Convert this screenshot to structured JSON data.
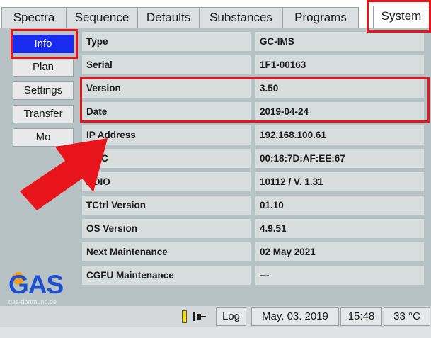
{
  "tabs": [
    {
      "label": "Spectra"
    },
    {
      "label": "Sequence"
    },
    {
      "label": "Defaults"
    },
    {
      "label": "Substances"
    },
    {
      "label": "Programs"
    },
    {
      "label": "System"
    }
  ],
  "sidebar": {
    "items": [
      {
        "label": "Info"
      },
      {
        "label": "Plan"
      },
      {
        "label": "Settings"
      },
      {
        "label": "Transfer"
      },
      {
        "label": "Mo"
      }
    ]
  },
  "info_rows": [
    {
      "label": "Type",
      "value": "GC-IMS"
    },
    {
      "label": "Serial",
      "value": "1F1-00163"
    },
    {
      "label": "Version",
      "value": "3.50"
    },
    {
      "label": "Date",
      "value": "2019-04-24"
    },
    {
      "label": "IP Address",
      "value": "192.168.100.61"
    },
    {
      "label": "MAC",
      "value": "00:18:7D:AF:EE:67"
    },
    {
      "label": "ADIO",
      "value": "10112 / V. 1.31"
    },
    {
      "label": "TCtrl Version",
      "value": "01.10"
    },
    {
      "label": "OS Version",
      "value": "4.9.51"
    },
    {
      "label": "Next Maintenance",
      "value": "02 May 2021"
    },
    {
      "label": "CGFU Maintenance",
      "value": "---"
    }
  ],
  "logo": {
    "text": "GAS",
    "subtitle": "gas-dortmund.de"
  },
  "statusbar": {
    "log_label": "Log",
    "date": "May. 03. 2019",
    "time": "15:48",
    "temperature": "33 °C"
  },
  "colors": {
    "accent_active": "#1a2bf0",
    "annotation_red": "#e8141c",
    "panel_bg": "#b6c2c4",
    "logo_blue": "#1e4fd0",
    "logo_orange": "#f0a020"
  },
  "annotations": {
    "arrow_icon": "red-arrow-icon"
  }
}
